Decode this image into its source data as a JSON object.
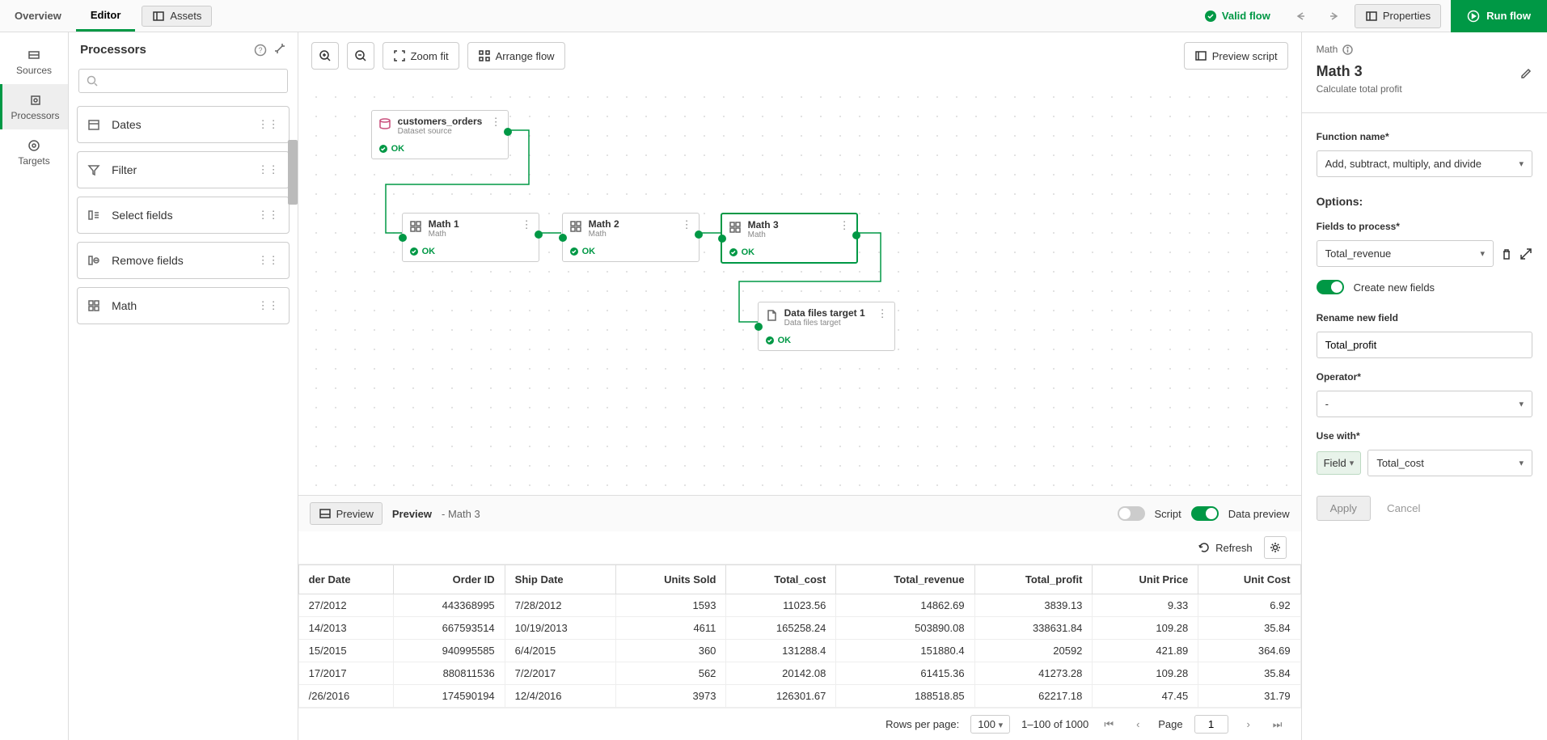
{
  "tabs": {
    "overview": "Overview",
    "editor": "Editor",
    "assets": "Assets"
  },
  "topbar": {
    "validFlow": "Valid flow",
    "properties": "Properties",
    "runFlow": "Run flow"
  },
  "leftTabs": {
    "sources": "Sources",
    "processors": "Processors",
    "targets": "Targets"
  },
  "procPanel": {
    "title": "Processors",
    "searchPlaceholder": "",
    "items": [
      "Dates",
      "Filter",
      "Select fields",
      "Remove fields",
      "Math"
    ]
  },
  "canvasToolbar": {
    "zoomFit": "Zoom fit",
    "arrangeFlow": "Arrange flow",
    "previewScript": "Preview script"
  },
  "nodes": {
    "src": {
      "title": "customers_orders",
      "sub": "Dataset source",
      "status": "OK"
    },
    "m1": {
      "title": "Math 1",
      "sub": "Math",
      "status": "OK"
    },
    "m2": {
      "title": "Math 2",
      "sub": "Math",
      "status": "OK"
    },
    "m3": {
      "title": "Math 3",
      "sub": "Math",
      "status": "OK"
    },
    "tgt": {
      "title": "Data files target 1",
      "sub": "Data files target",
      "status": "OK"
    }
  },
  "previewBar": {
    "preview": "Preview",
    "previewTitle": "Preview",
    "previewContext": "- Math 3",
    "script": "Script",
    "dataPreview": "Data preview"
  },
  "tableToolbar": {
    "refresh": "Refresh"
  },
  "table": {
    "headers": [
      "der Date",
      "Order ID",
      "Ship Date",
      "Units Sold",
      "Total_cost",
      "Total_revenue",
      "Total_profit",
      "Unit Price",
      "Unit Cost"
    ],
    "rows": [
      [
        "27/2012",
        "443368995",
        "7/28/2012",
        "1593",
        "11023.56",
        "14862.69",
        "3839.13",
        "9.33",
        "6.92"
      ],
      [
        "14/2013",
        "667593514",
        "10/19/2013",
        "4611",
        "165258.24",
        "503890.08",
        "338631.84",
        "109.28",
        "35.84"
      ],
      [
        "15/2015",
        "940995585",
        "6/4/2015",
        "360",
        "131288.4",
        "151880.4",
        "20592",
        "421.89",
        "364.69"
      ],
      [
        "17/2017",
        "880811536",
        "7/2/2017",
        "562",
        "20142.08",
        "61415.36",
        "41273.28",
        "109.28",
        "35.84"
      ],
      [
        "/26/2016",
        "174590194",
        "12/4/2016",
        "3973",
        "126301.67",
        "188518.85",
        "62217.18",
        "47.45",
        "31.79"
      ]
    ]
  },
  "pager": {
    "rowsPerPage": "Rows per page:",
    "perPage": "100",
    "range": "1–100 of 1000",
    "pageLabel": "Page",
    "page": "1"
  },
  "rightPanel": {
    "crumb": "Math",
    "title": "Math 3",
    "subtitle": "Calculate total profit",
    "functionNameLabel": "Function name*",
    "functionName": "Add, subtract, multiply, and divide",
    "optionsLabel": "Options:",
    "fieldsLabel": "Fields to process*",
    "fieldsValue": "Total_revenue",
    "createNew": "Create new fields",
    "renameLabel": "Rename new field",
    "renameValue": "Total_profit",
    "operatorLabel": "Operator*",
    "operatorValue": "-",
    "useWithLabel": "Use with*",
    "useWithType": "Field",
    "useWithValue": "Total_cost",
    "apply": "Apply",
    "cancel": "Cancel"
  }
}
